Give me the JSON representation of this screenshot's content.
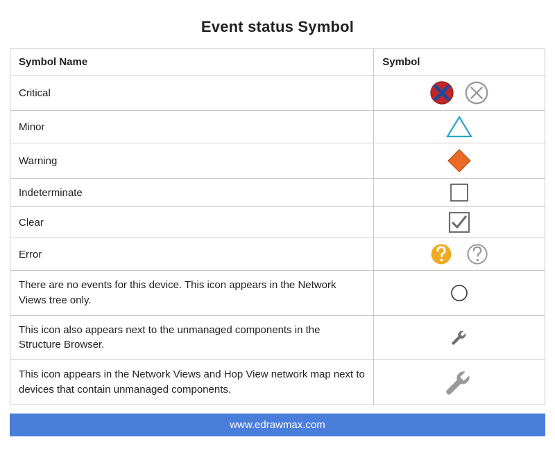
{
  "title": "Event status Symbol",
  "headers": {
    "name": "Symbol Name",
    "symbol": "Symbol"
  },
  "rows": [
    {
      "name": "Critical"
    },
    {
      "name": "Minor"
    },
    {
      "name": "Warning"
    },
    {
      "name": "Indeterminate"
    },
    {
      "name": "Clear"
    },
    {
      "name": "Error"
    },
    {
      "name": "There are no events for this device. This icon appears in the Network Views tree only."
    },
    {
      "name": "This icon also appears next to the unmanaged components in the Structure Browser."
    },
    {
      "name": "This icon appears in the Network Views and Hop View network map next to devices that contain unmanaged components."
    }
  ],
  "footer": "www.edrawmax.com",
  "colors": {
    "critical_fill": "#c22626",
    "critical_x": "#1b4aa0",
    "minor_stroke": "#2aa3c9",
    "warning_fill": "#e86a25",
    "clear_check": "#6f6f6f",
    "error_fill": "#eeaa22",
    "gray_outline": "#9a9a9a",
    "wrench_gray": "#6f6f6f",
    "footer_bg": "#4a7edb"
  }
}
